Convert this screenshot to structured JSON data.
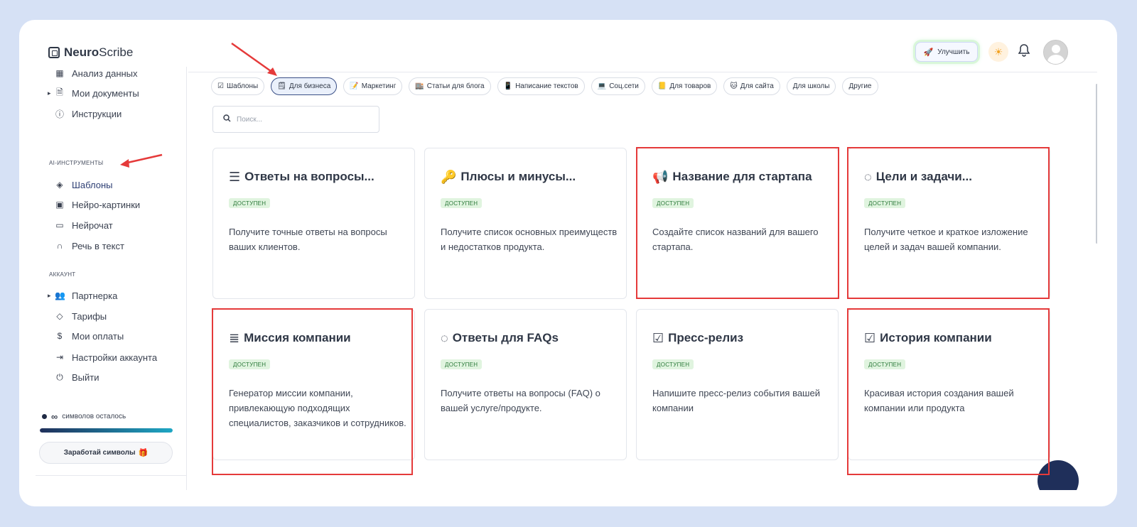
{
  "header": {
    "logo_bold": "Neuro",
    "logo_rest": "Scribe",
    "upgrade_label": "Улучшить"
  },
  "sidebar": {
    "items_top": [
      {
        "icon": "chart-icon",
        "label": "Анализ данных"
      },
      {
        "icon": "document-icon",
        "label": "Мои документы"
      },
      {
        "icon": "help-icon",
        "label": "Инструкции"
      }
    ],
    "section_ai": "AI-инструменты",
    "items_ai": [
      {
        "icon": "layers-icon",
        "label": "Шаблоны"
      },
      {
        "icon": "image-icon",
        "label": "Нейро-картинки"
      },
      {
        "icon": "chat-icon",
        "label": "Нейрочат"
      },
      {
        "icon": "headphones-icon",
        "label": "Речь в текст"
      }
    ],
    "section_account": "Аккаунт",
    "items_account": [
      {
        "icon": "users-icon",
        "label": "Партнерка"
      },
      {
        "icon": "tag-icon",
        "label": "Тарифы"
      },
      {
        "icon": "dollar-icon",
        "label": "Мои оплаты"
      },
      {
        "icon": "logout-icon",
        "label": "Настройки аккаунта"
      },
      {
        "icon": "power-icon",
        "label": "Выйти"
      }
    ],
    "symbols_infinity": "∞",
    "symbols_text": "символов осталось",
    "symbols_progress": 1.0,
    "earn_label": "Заработай символы"
  },
  "tabs": [
    {
      "icon": "☑",
      "label": "Шаблоны"
    },
    {
      "icon": "🗒",
      "label": "Для бизнеса"
    },
    {
      "icon": "📝",
      "label": "Маркетинг"
    },
    {
      "icon": "🏬",
      "label": "Статьи для блога"
    },
    {
      "icon": "📱",
      "label": "Написание текстов"
    },
    {
      "icon": "💻",
      "label": "Соц.сети"
    },
    {
      "icon": "📒",
      "label": "Для товаров"
    },
    {
      "icon": "🐱",
      "label": "Для сайта"
    },
    {
      "icon": "",
      "label": "Для школы"
    },
    {
      "icon": "",
      "label": "Другие"
    }
  ],
  "search": {
    "placeholder": "Поиск..."
  },
  "cards": [
    {
      "icon": "☰",
      "title": "Ответы на вопросы...",
      "badge": "доступен",
      "desc": "Получите точные ответы на вопросы ваших клиентов."
    },
    {
      "icon": "🔑",
      "title": "Плюсы и минусы...",
      "badge": "доступен",
      "desc": "Получите список основных преимуществ и недостатков продукта."
    },
    {
      "icon": "📢",
      "title": "Название для стартапа",
      "badge": "доступен",
      "desc": "Создайте список названий для вашего стартапа."
    },
    {
      "icon": "◌",
      "title": "Цели и задачи...",
      "badge": "доступен",
      "desc": "Получите четкое и краткое изложение целей и задач вашей компании."
    },
    {
      "icon": "≣",
      "title": "Миссия компании",
      "badge": "доступен",
      "desc": "Генератор миссии компании, привлекающую подходящих специалистов, заказчиков и сотрудников."
    },
    {
      "icon": "◌",
      "title": "Ответы для FAQs",
      "badge": "доступен",
      "desc": "Получите ответы на вопросы (FAQ) о вашей услуге/продукте."
    },
    {
      "icon": "☑",
      "title": "Пресс-релиз",
      "badge": "доступен",
      "desc": "Напишите пресс-релиз события вашей компании"
    },
    {
      "icon": "☑",
      "title": "История компании",
      "badge": "доступен",
      "desc": "Красивая история создания вашей компании или продукта"
    }
  ],
  "colors": {
    "highlight": "#e53a3a",
    "accent": "#2d3e73",
    "badge_bg": "#e0f4df"
  }
}
